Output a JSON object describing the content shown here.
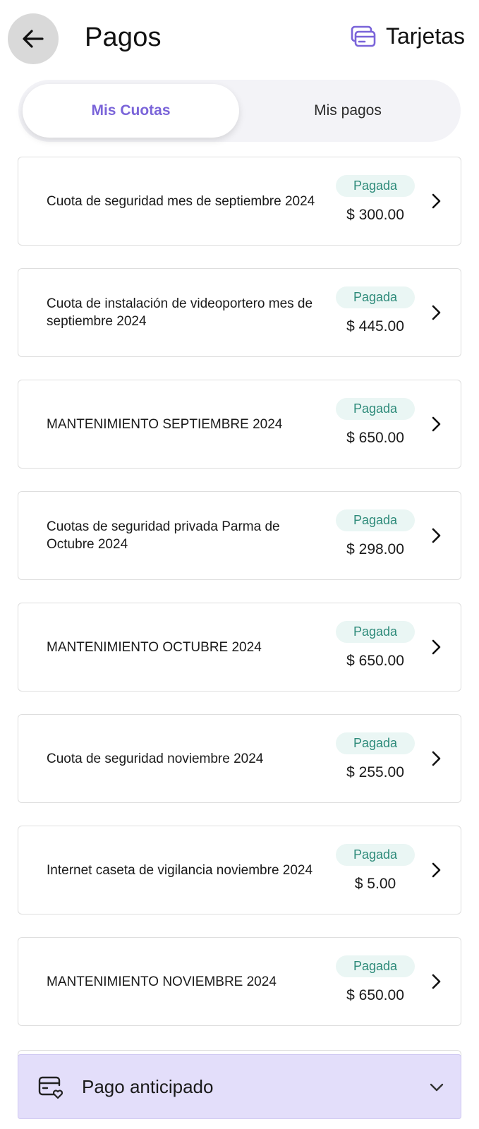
{
  "header": {
    "title": "Pagos",
    "cards_label": "Tarjetas"
  },
  "tabs": [
    {
      "label": "Mis Cuotas",
      "active": true
    },
    {
      "label": "Mis pagos",
      "active": false
    }
  ],
  "colors": {
    "accent": "#7a64d9",
    "paid_badge_bg": "#eaf6f4",
    "paid_badge_text": "#2e8b7a",
    "advance_bg": "#e3defa"
  },
  "fees": [
    {
      "description": "Cuota de seguridad mes de septiembre 2024",
      "status": "Pagada",
      "amount": "$ 300.00"
    },
    {
      "description": "Cuota de instalación de videoportero mes de septiembre 2024",
      "status": "Pagada",
      "amount": "$ 445.00"
    },
    {
      "description": "MANTENIMIENTO SEPTIEMBRE 2024",
      "status": "Pagada",
      "amount": "$ 650.00"
    },
    {
      "description": "Cuotas de seguridad privada Parma de Octubre 2024",
      "status": "Pagada",
      "amount": "$ 298.00"
    },
    {
      "description": "MANTENIMIENTO OCTUBRE 2024",
      "status": "Pagada",
      "amount": "$ 650.00"
    },
    {
      "description": "Cuota de seguridad noviembre 2024",
      "status": "Pagada",
      "amount": "$ 255.00"
    },
    {
      "description": "Internet caseta de vigilancia noviembre 2024",
      "status": "Pagada",
      "amount": "$ 5.00"
    },
    {
      "description": "MANTENIMIENTO NOVIEMBRE 2024",
      "status": "Pagada",
      "amount": "$ 650.00"
    }
  ],
  "advance_payment": {
    "label": "Pago anticipado",
    "icon": "card-heart-icon"
  }
}
